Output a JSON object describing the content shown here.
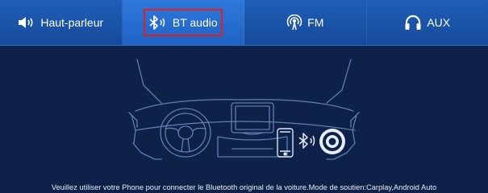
{
  "tabs": [
    {
      "label": "Haut-parleur",
      "icon": "speaker-icon"
    },
    {
      "label": "BT audio",
      "icon": "bluetooth-icon",
      "active": true
    },
    {
      "label": "FM",
      "icon": "radio-antenna-icon"
    },
    {
      "label": "AUX",
      "icon": "headphones-icon"
    }
  ],
  "hint": "Veuillez utiliser votre Phone pour connecter le Bluetooth original de la voiture.Mode de soutien:Carplay,Android Auto",
  "colors": {
    "background": "#0d2149",
    "tabbar": "#1f5eb8",
    "active_tab": "#2e78db",
    "highlight": "#e0211f",
    "line_art": "#5f7eae"
  }
}
